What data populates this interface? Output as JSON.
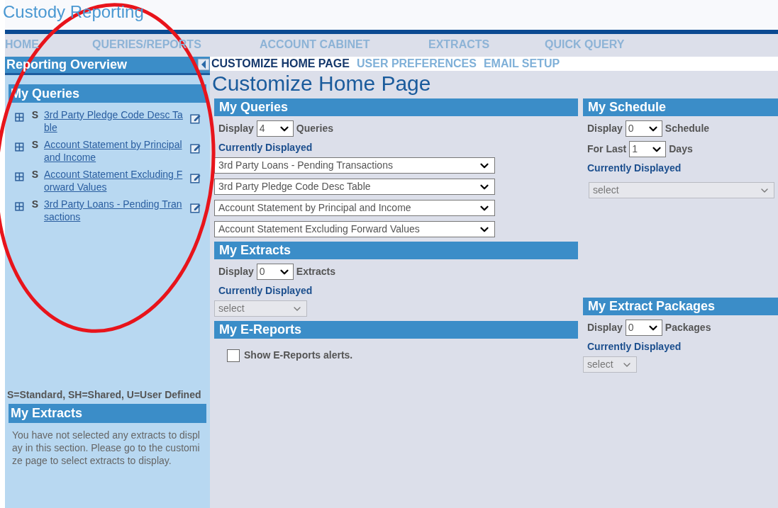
{
  "app_title": "Custody Reporting",
  "nav": [
    {
      "label": "HOME",
      "selected": false
    },
    {
      "label": "QUERIES/REPORTS",
      "selected": false
    },
    {
      "label": "ACCOUNT CABINET",
      "selected": false
    },
    {
      "label": "EXTRACTS",
      "selected": false
    },
    {
      "label": "QUICK QUERY",
      "selected": false
    }
  ],
  "sidebar": {
    "title": "Reporting Overview",
    "queries_title": "My Queries",
    "queries": [
      {
        "type": "S",
        "label": "3rd Party Pledge Code Desc Table"
      },
      {
        "type": "S",
        "label": "Account Statement by Principal and Income"
      },
      {
        "type": "S",
        "label": "Account Statement Excluding Forward Values"
      },
      {
        "type": "S",
        "label": "3rd Party Loans - Pending Transactions"
      }
    ],
    "legend": "S=Standard, SH=Shared, U=User Defined",
    "extracts_title": "My Extracts",
    "extracts_message": "You have not selected any extracts to display in this section. Please go to the customize page to select extracts to display."
  },
  "subnav": [
    {
      "label": "CUSTOMIZE HOME PAGE",
      "selected": true
    },
    {
      "label": "USER PREFERENCES",
      "selected": false
    },
    {
      "label": "EMAIL SETUP",
      "selected": false
    }
  ],
  "page_title": "Customize Home Page",
  "columns": [
    [
      {
        "title": "My Queries",
        "rows": [
          {
            "kind": "count",
            "label": "Display",
            "value": "4",
            "unit": "Queries"
          }
        ],
        "current": "Currently Displayed",
        "selects": [
          {
            "value": "3rd Party Loans - Pending Transactions",
            "disabled": false
          },
          {
            "value": "3rd Party Pledge Code Desc Table",
            "disabled": false
          },
          {
            "value": "Account Statement by Principal and Income",
            "disabled": false
          },
          {
            "value": "Account Statement Excluding Forward Values",
            "disabled": false
          }
        ]
      },
      {
        "title": "My Extracts",
        "rows": [
          {
            "kind": "count",
            "label": "Display",
            "value": "0",
            "unit": "Extracts"
          }
        ],
        "current": "Currently Displayed",
        "selects": [
          {
            "placeholder": "select",
            "disabled": true
          }
        ]
      },
      {
        "title": "My E-Reports",
        "checkbox": {
          "label": "Show E-Reports alerts.",
          "checked": false
        }
      }
    ],
    [
      {
        "title": "My Schedule",
        "rows": [
          {
            "kind": "count",
            "label": "Display",
            "value": "0",
            "unit": "Schedule"
          },
          {
            "kind": "count",
            "label": "For Last",
            "value": "1",
            "unit": "Days"
          }
        ],
        "current": "Currently Displayed",
        "selects": [
          {
            "placeholder": "select",
            "disabled": true
          }
        ]
      },
      {
        "title": "My Extract Packages",
        "rows": [
          {
            "kind": "count",
            "label": "Display",
            "value": "0",
            "unit": "Packages"
          }
        ],
        "current": "Currently Displayed",
        "selects": [
          {
            "placeholder": "select",
            "disabled": true
          }
        ]
      }
    ]
  ],
  "annotations": [
    {
      "kind": "ellipse"
    }
  ]
}
